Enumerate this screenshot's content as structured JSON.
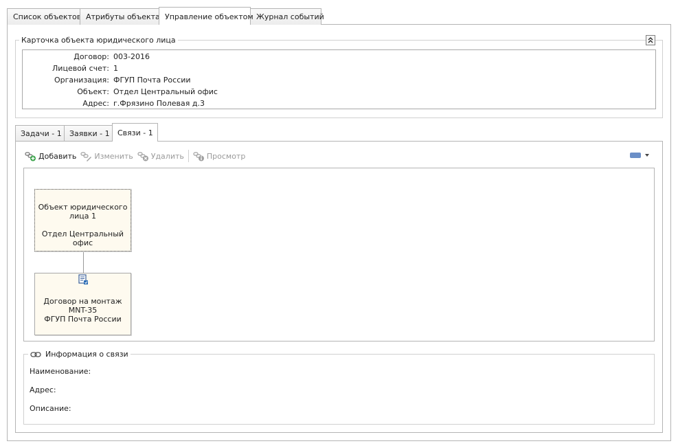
{
  "top_tabs": [
    {
      "label": "Список объектов"
    },
    {
      "label": "Атрибуты объекта"
    },
    {
      "label": "Управление объектом"
    },
    {
      "label": "Журнал событий"
    }
  ],
  "object_card": {
    "caption": "Карточка объекта юридического лица",
    "fields": [
      {
        "label": "Договор:",
        "value": "003-2016"
      },
      {
        "label": "Лицевой счет:",
        "value": "1"
      },
      {
        "label": "Организация:",
        "value": "ФГУП Почта России"
      },
      {
        "label": "Объект:",
        "value": "Отдел Центральный офис"
      },
      {
        "label": "Адрес:",
        "value": "г.Фрязино Полевая д.3"
      }
    ]
  },
  "sub_tabs": [
    {
      "label": "Задачи - 1"
    },
    {
      "label": "Заявки - 1"
    },
    {
      "label": "Связи - 1"
    }
  ],
  "toolbar": {
    "add": "Добавить",
    "edit": "Изменить",
    "delete": "Удалить",
    "view": "Просмотр",
    "accent_color": "#6b8fc7"
  },
  "diagram": {
    "node_object": {
      "line1": "Объект юридического",
      "line2": "лица 1",
      "line3": "Отдел Центральный офис"
    },
    "node_contract": {
      "line1": "Договор на монтаж MNT-35",
      "line2": "ФГУП Почта России",
      "icon": "contract-icon"
    }
  },
  "link_info": {
    "caption": "Информация о связи",
    "name_label": "Наименование:",
    "address_label": "Адрес:",
    "description_label": "Описание:"
  }
}
